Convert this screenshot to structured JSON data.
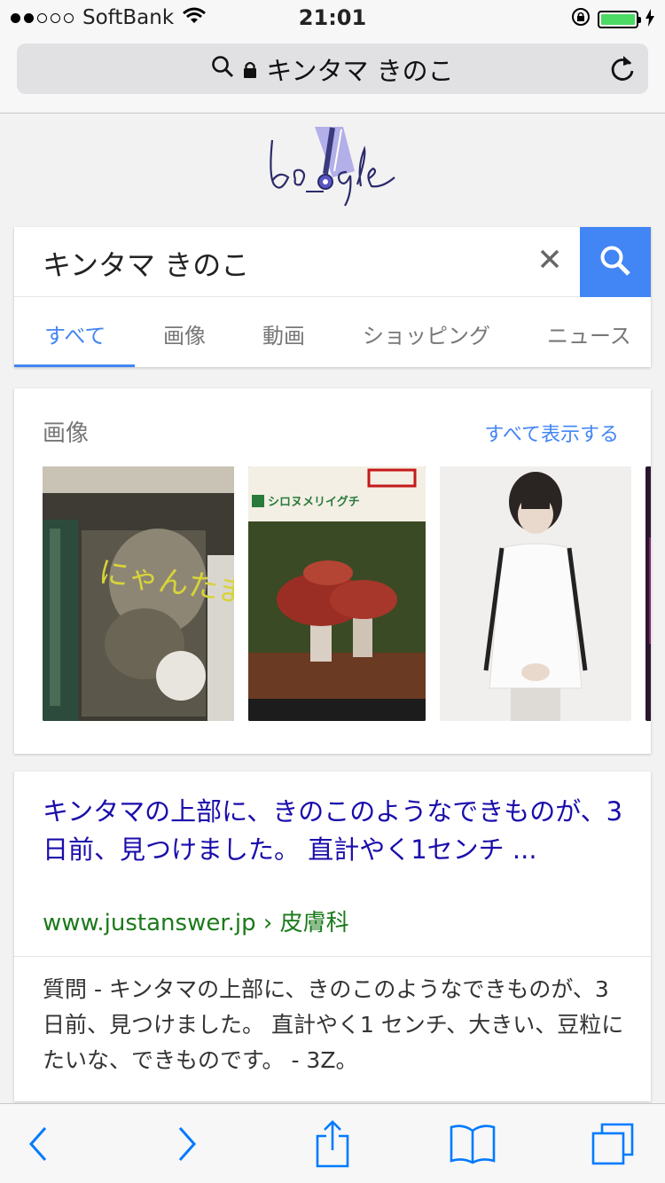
{
  "status_bar": {
    "carrier": "SoftBank",
    "time": "21:01",
    "signal_bars_filled": 2,
    "signal_bars_total": 5,
    "battery_level": 1.0
  },
  "address_bar": {
    "query": "キンタマ きのこ"
  },
  "search": {
    "query": "キンタマ きのこ",
    "tabs": [
      {
        "label": "すべて",
        "active": true
      },
      {
        "label": "画像",
        "active": false
      },
      {
        "label": "動画",
        "active": false
      },
      {
        "label": "ショッピング",
        "active": false
      },
      {
        "label": "ニュース",
        "active": false
      }
    ]
  },
  "images": {
    "heading": "画像",
    "see_all": "すべて表示する",
    "book_text": "にゃんたま",
    "mushroom_caption": "シロヌメリイグチ"
  },
  "result": {
    "title": "キンタマの上部に、きのこのようなできものが、3日前、見つけました。 直計やく1センチ ...",
    "url": "www.justanswer.jp",
    "url_crumb": "› 皮膚科",
    "snippet": "質問 - キンタマの上部に、きのこのようなできものが、3日前、見つけました。 直計やく1 センチ、大きい、豆粒にたいな、できものです。 - 3Z。"
  },
  "colors": {
    "accent": "#4285f4",
    "link": "#1a0dab",
    "url": "#1b7a1b",
    "ios_blue": "#007aff",
    "battery": "#4cd964"
  },
  "icons": [
    "wifi-icon",
    "lock-icon",
    "battery-icon",
    "search-icon",
    "reload-icon",
    "close-icon",
    "back-icon",
    "forward-icon",
    "share-icon",
    "bookmarks-icon",
    "tabs-icon"
  ]
}
